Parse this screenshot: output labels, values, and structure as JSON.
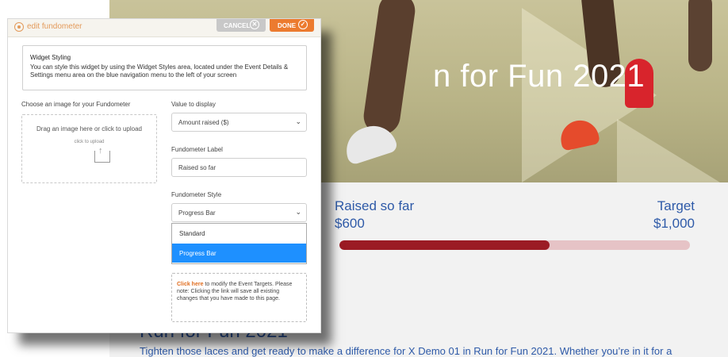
{
  "colors": {
    "accent_orange": "#ec7b2f",
    "cancel_gray": "#c8c8c8",
    "link_orange": "#e06d1f",
    "brand_blue": "#2e5aa8",
    "progress_fill": "#9b1b24",
    "progress_track": "#e6c3c6",
    "selected_option": "#1e90ff"
  },
  "modal": {
    "title": "edit fundometer",
    "cancel_label": "CANCEL",
    "done_label": "DONE",
    "info_title": "Widget Styling",
    "info_body": "You can style this widget by using the Widget Styles area, located under the Event Details & Settings menu area on the blue navigation menu to the left of your screen",
    "image_label": "Choose an image for your Fundometer",
    "upload_main": "Drag an image here or click to upload",
    "upload_sub": "click to upload",
    "value_label": "Value to display",
    "value_selected": "Amount raised ($)",
    "fundometer_label_title": "Fundometer Label",
    "fundometer_label_value": "Raised so far",
    "style_label": "Fundometer Style",
    "style_selected": "Progress Bar",
    "style_options": [
      "Standard",
      "Progress Bar"
    ],
    "note_link": "Click here",
    "note_text": " to modify the Event Targets. Please note: Clicking the link will save all existing changes that you have made to this page."
  },
  "page": {
    "hero_title": "n for Fun 2021",
    "raised_label": "Raised so far",
    "raised_amount": "$600",
    "target_label": "Target",
    "target_amount": "$1,000",
    "progress_fraction": 0.6,
    "article_title": "Run for Fun 2021",
    "article_text": "Tighten those laces and get ready to make a difference for X Demo 01 in Run for Fun 2021. Whether you’re in it for a"
  }
}
